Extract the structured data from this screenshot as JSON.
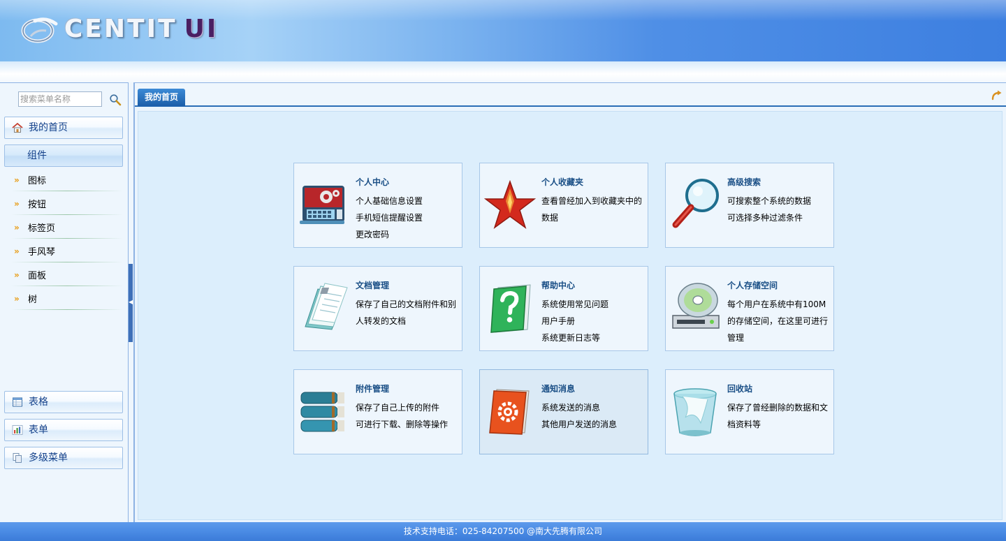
{
  "header": {
    "logo_text": "CENTIT",
    "logo_suffix": "UI"
  },
  "sidebar": {
    "search": {
      "placeholder": "搜索菜单名称",
      "value": "",
      "icon": "search-icon"
    },
    "home": {
      "label": "我的首页",
      "icon": "home-icon"
    },
    "components": {
      "label": "组件",
      "items": [
        {
          "label": "图标"
        },
        {
          "label": "按钮"
        },
        {
          "label": "标签页"
        },
        {
          "label": "手风琴"
        },
        {
          "label": "面板"
        },
        {
          "label": "树"
        }
      ]
    },
    "sections": [
      {
        "label": "表格",
        "icon": "table-icon"
      },
      {
        "label": "表单",
        "icon": "chart-icon"
      },
      {
        "label": "多级菜单",
        "icon": "pages-icon"
      }
    ]
  },
  "tabs": {
    "active": "我的首页",
    "action_icon": "return-arrow-icon"
  },
  "cards": [
    {
      "title": "个人中心",
      "lines": [
        "个人基础信息设置",
        "手机短信提醒设置",
        "更改密码"
      ],
      "icon": "control-panel-icon"
    },
    {
      "title": "个人收藏夹",
      "lines": [
        "查看曾经加入到收藏夹中的数据"
      ],
      "icon": "star-icon"
    },
    {
      "title": "高级搜索",
      "lines": [
        "可搜索整个系统的数据",
        "可选择多种过滤条件"
      ],
      "icon": "magnifier-icon"
    },
    {
      "title": "文档管理",
      "lines": [
        "保存了自己的文档附件和别人转发的文档"
      ],
      "icon": "documents-icon"
    },
    {
      "title": "帮助中心",
      "lines": [
        "系统使用常见问题",
        "用户手册",
        "系统更新日志等"
      ],
      "icon": "help-book-icon"
    },
    {
      "title": "个人存储空间",
      "lines": [
        "每个用户在系统中有100M的存储空间，在这里可进行管理"
      ],
      "icon": "disk-drive-icon"
    },
    {
      "title": "附件管理",
      "lines": [
        "保存了自己上传的附件",
        "可进行下载、删除等操作"
      ],
      "icon": "books-icon"
    },
    {
      "title": "通知消息",
      "lines": [
        "系统发送的消息",
        "其他用户发送的消息"
      ],
      "icon": "settings-book-icon"
    },
    {
      "title": "回收站",
      "lines": [
        "保存了曾经删除的数据和文档资料等"
      ],
      "icon": "recycle-bin-icon"
    }
  ],
  "footer": {
    "text": "技术支持电话：025-84207500 @南大先腾有限公司"
  }
}
